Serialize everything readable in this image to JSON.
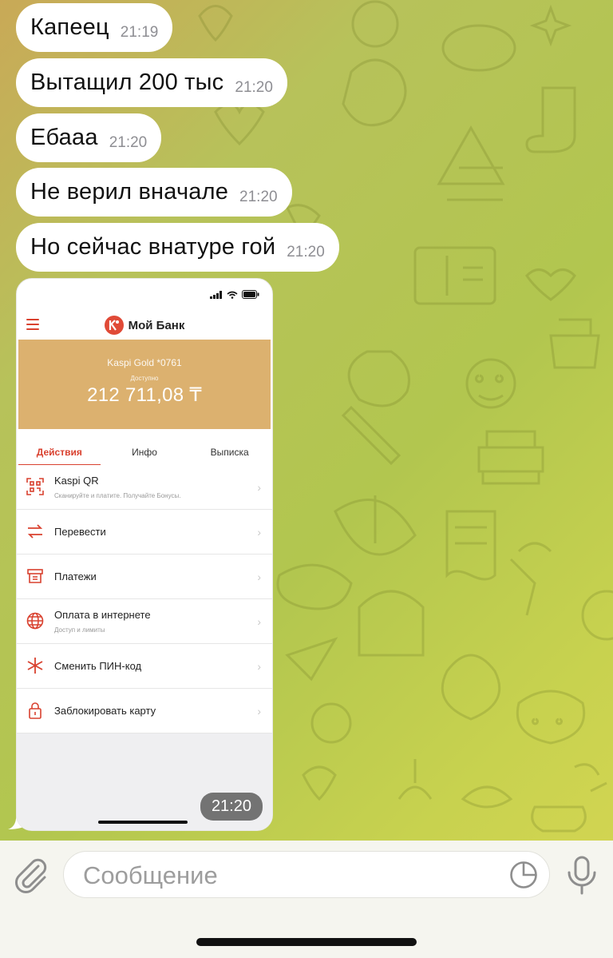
{
  "messages": [
    {
      "text": "Капеец",
      "time": "21:19"
    },
    {
      "text": "Вытащил 200 тыс",
      "time": "21:20"
    },
    {
      "text": "Ебааа",
      "time": "21:20"
    },
    {
      "text": "Не верил вначале",
      "time": "21:20"
    },
    {
      "text": "Но сейчас внатуре гой",
      "time": "21:20"
    }
  ],
  "photo": {
    "time": "21:20",
    "bank": {
      "title": "Мой Банк",
      "card_name": "Kaspi Gold *0761",
      "available_label": "Доступно",
      "balance": "212 711,08 ₸",
      "tabs": [
        "Действия",
        "Инфо",
        "Выписка"
      ],
      "actions": [
        {
          "label": "Kaspi QR",
          "sub": "Сканируйте и платите. Получайте Бонусы.",
          "icon": "qr-icon"
        },
        {
          "label": "Перевести",
          "sub": "",
          "icon": "transfer-icon"
        },
        {
          "label": "Платежи",
          "sub": "",
          "icon": "payments-icon"
        },
        {
          "label": "Оплата в интернете",
          "sub": "Доступ и лимиты",
          "icon": "globe-icon"
        },
        {
          "label": "Сменить ПИН-код",
          "sub": "",
          "icon": "asterisk-icon"
        },
        {
          "label": "Заблокировать карту",
          "sub": "",
          "icon": "lock-icon"
        }
      ]
    }
  },
  "composer": {
    "placeholder": "Сообщение"
  },
  "colors": {
    "accent": "#d9412f",
    "card": "#dcb16f",
    "bubble": "#ffffff"
  }
}
